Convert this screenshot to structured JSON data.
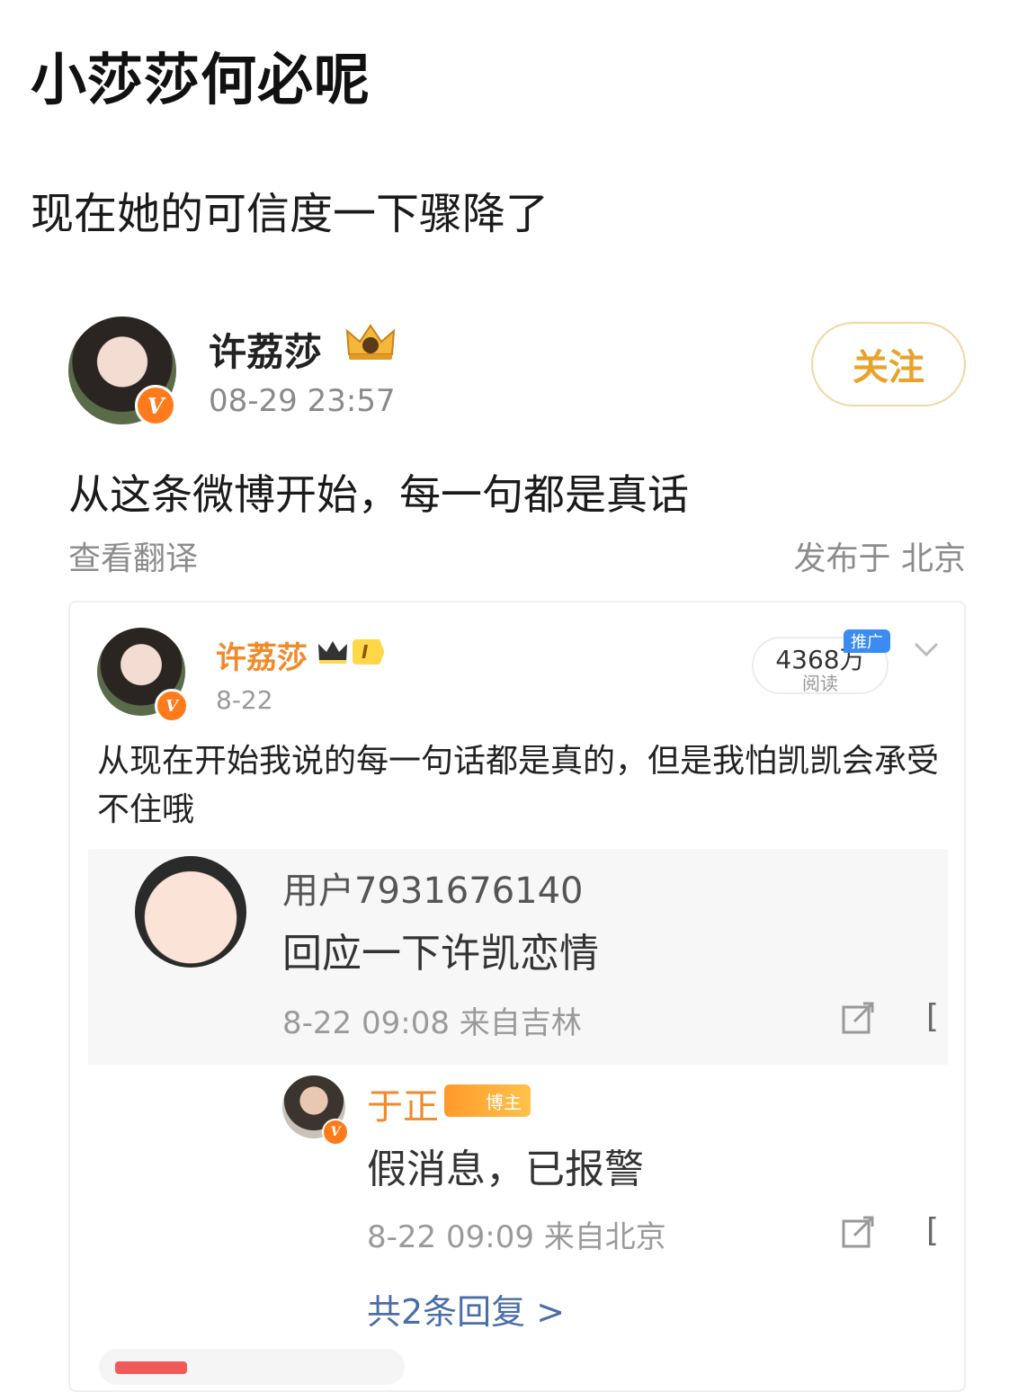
{
  "header": {
    "title": "小莎莎何必呢",
    "subtitle": "现在她的可信度一下骤降了"
  },
  "post": {
    "author": "许荔莎",
    "time": "08-29 23:57",
    "follow_label": "关注",
    "text": "从这条微博开始，每一句都是真话",
    "translate_label": "查看翻译",
    "location": "发布于 北京"
  },
  "quoted": {
    "author": "许荔莎",
    "level": "I",
    "date": "8-22",
    "reads_count": "4368万",
    "reads_label": "阅读",
    "promo_label": "推广",
    "text": "从现在开始我说的每一句话都是真的，但是我怕凯凯会承受不住哦",
    "replies": [
      {
        "user": "用户7931676140",
        "text": "回应一下许凯恋情",
        "meta": "8-22 09:08 来自吉林"
      },
      {
        "user": "于正",
        "badge": "博主",
        "text": "假消息，已报警",
        "meta": "8-22 09:09 来自北京"
      }
    ],
    "more_replies": "共2条回复 >"
  },
  "icons": {
    "verified": "verified-v-icon",
    "crown": "crown-icon",
    "share": "share-out-icon",
    "chevron": "chevron-down-icon"
  },
  "colors": {
    "accent_orange": "#f08a2a",
    "follow_gold": "#e8a32a",
    "link_blue": "#4a6ea8",
    "promo_blue": "#3a8bf2"
  }
}
